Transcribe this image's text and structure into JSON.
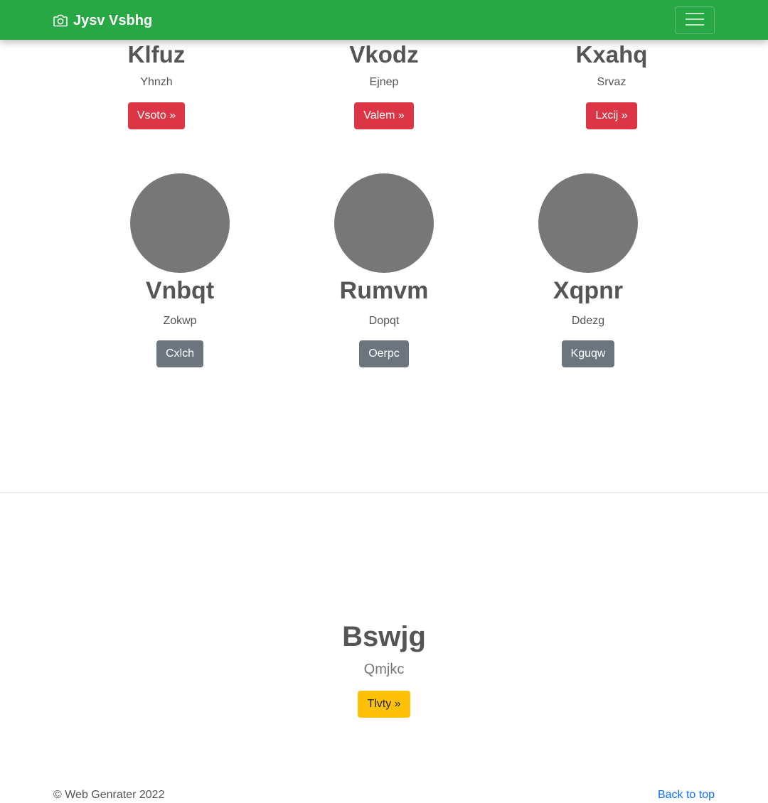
{
  "navbar": {
    "brand": "Jysv Vsbhg",
    "brand_icon": "camera-icon",
    "toggler_icon": "hamburger-menu-icon",
    "color": "#28a745"
  },
  "features": [
    {
      "title": "Klfuz",
      "subtitle": "Yhnzh",
      "button": "Vsoto »"
    },
    {
      "title": "Vkodz",
      "subtitle": "Ejnep",
      "button": "Valem »"
    },
    {
      "title": "Kxahq",
      "subtitle": "Srvaz",
      "button": "Lxcij »"
    }
  ],
  "marketing": [
    {
      "title": "Vnbqt",
      "subtitle": "Zokwp",
      "button": "Cxlch"
    },
    {
      "title": "Rumvm",
      "subtitle": "Dopqt",
      "button": "Oerpc"
    },
    {
      "title": "Xqpnr",
      "subtitle": "Ddezg",
      "button": "Kguqw"
    }
  ],
  "hero": {
    "title": "Bswjg",
    "subtitle": "Qmjkc",
    "button": "Tlvty »"
  },
  "footer": {
    "copyright": "© Web Genrater 2022",
    "back_to_top": "Back to top"
  },
  "colors": {
    "danger": "#dc3545",
    "secondary": "#6c757d",
    "warning": "#ffc107",
    "link": "#0d6efd"
  }
}
